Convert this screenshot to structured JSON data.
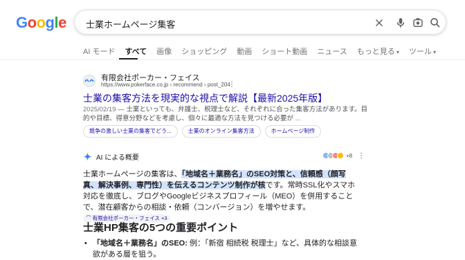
{
  "logo": {
    "letters": [
      "G",
      "o",
      "o",
      "g",
      "l",
      "e"
    ],
    "colors": [
      "#4285F4",
      "#EA4335",
      "#FBBC05",
      "#4285F4",
      "#34A853",
      "#EA4335"
    ]
  },
  "search": {
    "query": "士業ホームページ集客"
  },
  "tabs": [
    {
      "label": "AI モード",
      "active": false
    },
    {
      "label": "すべて",
      "active": true
    },
    {
      "label": "画像",
      "active": false
    },
    {
      "label": "ショッピング",
      "active": false
    },
    {
      "label": "動画",
      "active": false
    },
    {
      "label": "ショート動画",
      "active": false
    },
    {
      "label": "ニュース",
      "active": false
    },
    {
      "label": "もっと見る",
      "active": false
    },
    {
      "label": "ツール",
      "active": false
    }
  ],
  "result": {
    "site_name": "有限会社ポーカー・フェイス",
    "url": "https://www.pokerface.co.jp › recommend › post_204",
    "title": "士業の集客方法を現実的な視点で解説【最新2025年版】",
    "date": "2025/02/19",
    "snippet": " — 士業といっても、弁護士、税理士など、それぞれに合った集客方法があります。目的や目標、得意分野などを考慮し、個々に最適な方法を見つける必要が ..."
  },
  "chips": [
    "競争の激しい士業の集客でどう...",
    "士業のオンライン集客方法",
    "ホームページ制作"
  ],
  "ai_overview": {
    "label": "AI による概要",
    "sources_count": "+8",
    "body_pre": "士業ホームページの集客は、",
    "body_hl": "「地域名＋業務名」のSEO対策と、信頼感（顔写真、解決事例、専門性）を伝えるコンテンツ制作が核",
    "body_post": "です。常時SSL化やスマホ対応を徹底し、ブログやGoogleビジネスプロフィール（MEO）を併用することで、潜在顧客からの相談・依頼（コンバージョン）を増やせます。",
    "citation": "有限会社ポーカー・フェイス +3"
  },
  "section_heading": "士業HP集客の5つの重要ポイント",
  "bullet": {
    "bold": "「地域名＋業務名」のSEO:",
    "text": " 例：「新宿 相続税 税理士」など、具体的な相談意欲がある層を狙う。"
  }
}
